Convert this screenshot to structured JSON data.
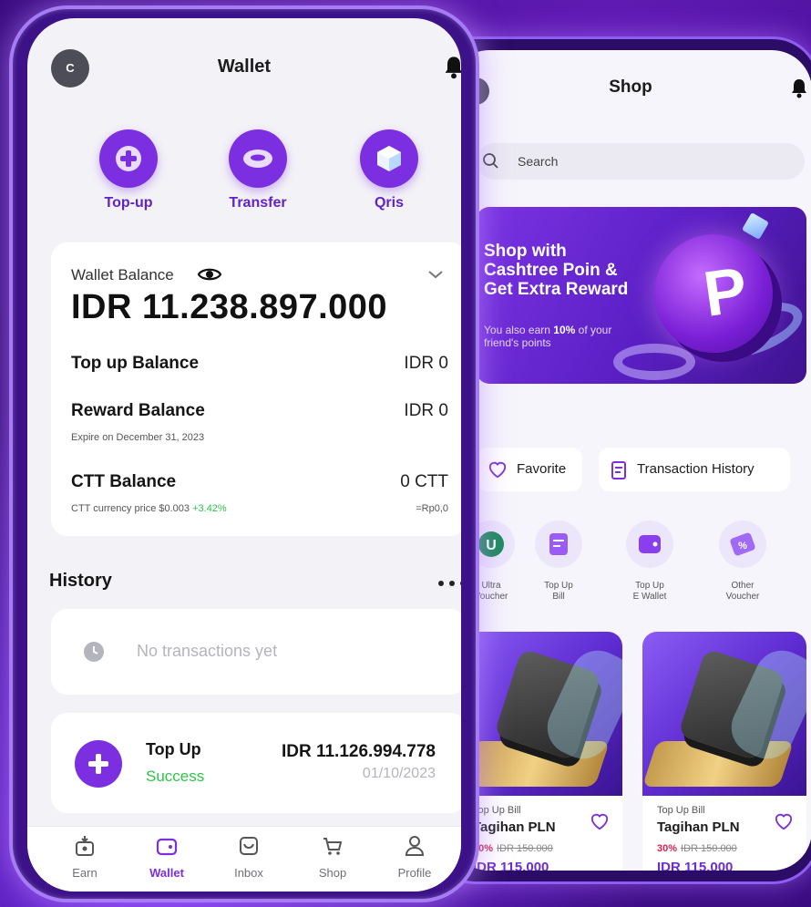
{
  "shop": {
    "title": "Shop",
    "search_placeholder": "Search",
    "banner": {
      "title": "Shop with Cashtree Poin & Get Extra Reward",
      "sub_pre": "You also earn ",
      "sub_highlight": "10%",
      "sub_post": " of your friend's points",
      "coin_letter": "P"
    },
    "pills": {
      "favorite": "Favorite",
      "history": "Transaction History"
    },
    "categories": [
      {
        "label1": "Ultra",
        "label2": "Voucher"
      },
      {
        "label1": "Top Up",
        "label2": "Bill"
      },
      {
        "label1": "Top Up",
        "label2": "E Wallet"
      },
      {
        "label1": "Other",
        "label2": "Voucher"
      }
    ],
    "products": [
      {
        "category": "Top Up Bill",
        "name": "Tagihan PLN",
        "discount": "30%",
        "old_price": "IDR 150.000",
        "price": "IDR 115.000"
      },
      {
        "category": "Top Up Bill",
        "name": "Tagihan PLN",
        "discount": "30%",
        "old_price": "IDR 150.000",
        "price": "IDR 115.000"
      }
    ]
  },
  "wallet": {
    "avatar_initial": "C",
    "title": "Wallet",
    "actions": {
      "topup": "Top-up",
      "transfer": "Transfer",
      "qris": "Qris"
    },
    "balance": {
      "label": "Wallet Balance",
      "amount": "IDR 11.238.897.000",
      "topup_label": "Top up Balance",
      "topup_value": "IDR 0",
      "reward_label": "Reward Balance",
      "reward_value": "IDR 0",
      "reward_expire": "Expire on December 31, 2023",
      "ctt_label": "CTT Balance",
      "ctt_value": "0 CTT",
      "ctt_price": "CTT currency price $0.003",
      "ctt_change": "+3.42%",
      "ctt_idr": "=Rp0,0"
    },
    "history": {
      "title": "History",
      "empty": "No transactions yet",
      "transaction": {
        "name": "Top Up",
        "status": "Success",
        "amount": "IDR 11.126.994.778",
        "date": "01/10/2023"
      }
    },
    "tabs": {
      "earn": "Earn",
      "wallet": "Wallet",
      "inbox": "Inbox",
      "shop": "Shop",
      "profile": "Profile"
    }
  },
  "colors": {
    "accent": "#7b2fe0",
    "success": "#2ec44a",
    "discount": "#e0204f",
    "background": "#4a0f99"
  }
}
